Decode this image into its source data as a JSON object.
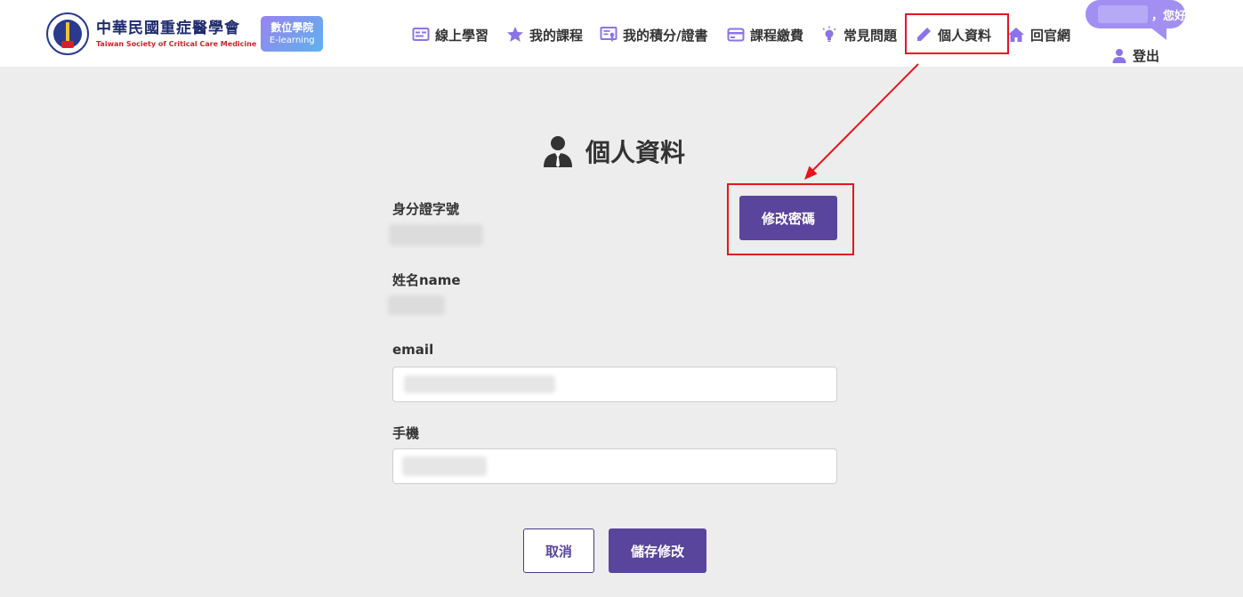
{
  "header": {
    "org_name_zh": "中華民國重症醫學會",
    "org_name_en": "Taiwan Society of Critical Care Medicine",
    "badge_line1": "數位學院",
    "badge_line2": "E-learning",
    "nav": [
      {
        "label": "線上學習",
        "icon": "online-learning-icon"
      },
      {
        "label": "我的課程",
        "icon": "star-icon"
      },
      {
        "label": "我的積分/證書",
        "icon": "certificate-icon"
      },
      {
        "label": "課程繳費",
        "icon": "credit-card-icon"
      },
      {
        "label": "常見問題",
        "icon": "lightbulb-icon"
      },
      {
        "label": "個人資料",
        "icon": "pencil-icon"
      },
      {
        "label": "回官網",
        "icon": "home-icon"
      }
    ],
    "greeting_suffix": "，您好",
    "logout_label": "登出"
  },
  "colors": {
    "accent": "#5a459c",
    "nav_icon": "#8b74e8",
    "greeting_bubble": "#a190f2",
    "annotation_red": "#e8141d",
    "background": "#ededed"
  },
  "main": {
    "title": "個人資料",
    "id_label": "身分證字號",
    "name_label": "姓名name",
    "email_label": "email",
    "phone_label": "手機",
    "change_password_label": "修改密碼",
    "cancel_label": "取消",
    "save_label": "儲存修改"
  }
}
